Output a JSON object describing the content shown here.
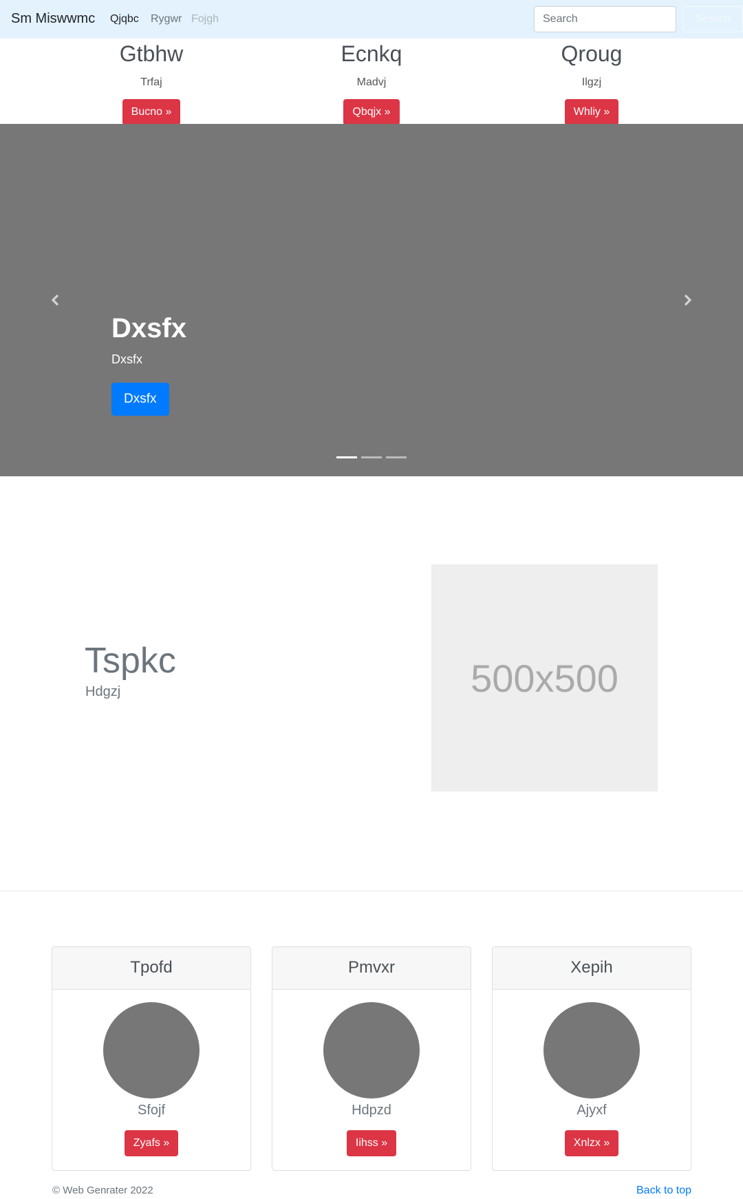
{
  "navbar": {
    "brand": "Sm Miswwmc",
    "links": [
      "Qjqbc",
      "Rygwr",
      "Fojgh"
    ],
    "search_placeholder": "Search",
    "search_button": "Search"
  },
  "features": [
    {
      "title": "Gtbhw",
      "text": "Trfaj",
      "button": "Bucno »"
    },
    {
      "title": "Ecnkq",
      "text": "Madvj",
      "button": "Qbqjx »"
    },
    {
      "title": "Qroug",
      "text": "Ilgzj",
      "button": "Whliy »"
    }
  ],
  "carousel": {
    "caption_title": "Dxsfx",
    "caption_text": "Dxsfx",
    "caption_button": "Dxsfx",
    "slide_count": 3,
    "active_index": 0
  },
  "featurette": {
    "heading": "Tspkc",
    "subheading": "Hdgzj",
    "image_label": "500x500"
  },
  "cards": [
    {
      "header": "Tpofd",
      "name": "Sfojf",
      "button": "Zyafs »"
    },
    {
      "header": "Pmvxr",
      "name": "Hdpzd",
      "button": "Iihss »"
    },
    {
      "header": "Xepih",
      "name": "Ajyxf",
      "button": "Xnlzx »"
    }
  ],
  "footer": {
    "copyright": "© Web Genrater 2022",
    "back_to_top": "Back to top"
  },
  "colors": {
    "navbar_bg": "#e3f2fd",
    "danger": "#dc3545",
    "primary": "#007bff",
    "carousel_bg": "#777777"
  }
}
